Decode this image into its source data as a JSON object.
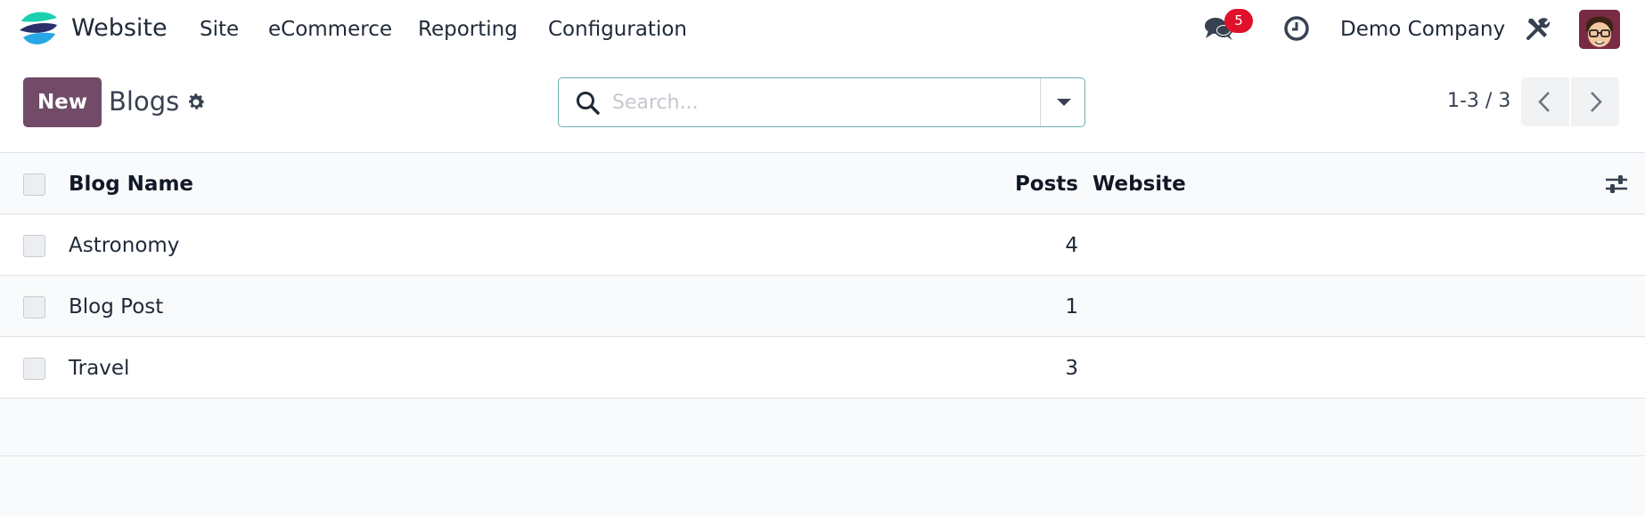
{
  "navbar": {
    "app_name": "Website",
    "menus": [
      "Site",
      "eCommerce",
      "Reporting",
      "Configuration"
    ],
    "messages_count": "5",
    "company": "Demo Company",
    "icons": [
      "chat-icon",
      "clock-icon",
      "tools-icon"
    ]
  },
  "control_panel": {
    "new_label": "New",
    "breadcrumb": "Blogs",
    "search_placeholder": "Search...",
    "pager": "1-3 / 3"
  },
  "list": {
    "columns": {
      "name": "Blog Name",
      "posts": "Posts",
      "website": "Website"
    },
    "rows": [
      {
        "name": "Astronomy",
        "posts": "4",
        "website": ""
      },
      {
        "name": "Blog Post",
        "posts": "1",
        "website": ""
      },
      {
        "name": "Travel",
        "posts": "3",
        "website": ""
      }
    ]
  },
  "colors": {
    "primary": "#714b67",
    "badge": "#e0112b",
    "search_border": "#6db3b0"
  }
}
